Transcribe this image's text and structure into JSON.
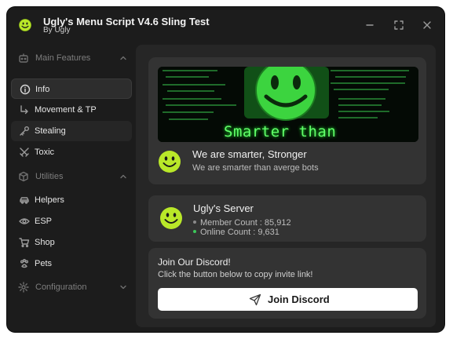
{
  "window": {
    "title": "Ugly's Menu Script V4.6 Sling Test",
    "subtitle": "By Ugly"
  },
  "sidebar": {
    "groups": [
      {
        "label": "Main Features",
        "icon": "robot-icon",
        "expanded": true,
        "items": [
          {
            "label": "Info",
            "icon": "info-icon",
            "active": true
          },
          {
            "label": "Movement & TP",
            "icon": "corner-arrow-icon"
          },
          {
            "label": "Stealing",
            "icon": "key-icon"
          },
          {
            "label": "Toxic",
            "icon": "swords-icon"
          }
        ]
      },
      {
        "label": "Utilities",
        "icon": "cube-icon",
        "expanded": true,
        "items": [
          {
            "label": "Helpers",
            "icon": "car-icon"
          },
          {
            "label": "ESP",
            "icon": "eye-icon"
          },
          {
            "label": "Shop",
            "icon": "cart-icon"
          },
          {
            "label": "Pets",
            "icon": "paw-icon"
          }
        ]
      },
      {
        "label": "Configuration",
        "icon": "gear-icon",
        "expanded": false,
        "items": []
      }
    ]
  },
  "info_card": {
    "banner_text": "Smarter than",
    "heading": "We are smarter, Stronger",
    "description": "We are smarter than averge bots"
  },
  "server_card": {
    "heading": "Ugly's Server",
    "member_count": "Member Count : 85,912",
    "online_count": "Online Count : 9,631",
    "member_dot_color": "#8a8a8a",
    "online_dot_color": "#3cc85a"
  },
  "discord_card": {
    "heading": "Join Our Discord!",
    "description": "Click the button below to copy invite link!",
    "button_label": "Join Discord"
  },
  "colors": {
    "accent_green": "#62ff6a",
    "smiley_yellow": "#b9e829",
    "window_bg": "#1c1c1c",
    "panel_bg": "#262626",
    "card_bg": "#333333"
  }
}
